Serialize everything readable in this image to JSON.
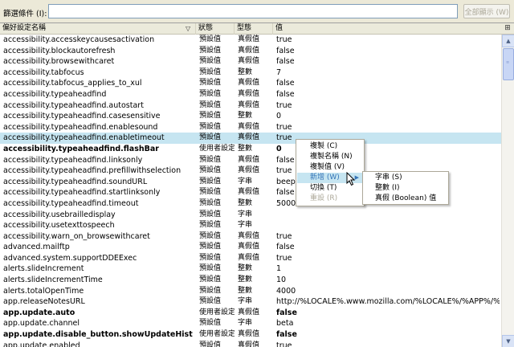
{
  "filter": {
    "label": "篩選條件 (I):",
    "value": "",
    "show_all_label": "全部顯示 (W)"
  },
  "columns": {
    "name": "偏好設定名稱",
    "status": "狀態",
    "type": "型態",
    "value": "值"
  },
  "icons": {
    "sort": "sort-indicator-icon",
    "column_picker": "column-picker-icon",
    "scroll_up": "scroll-up-arrow-icon",
    "scroll_down": "scroll-down-arrow-icon",
    "pointer": "mouse-pointer-icon"
  },
  "colors": {
    "selection": "#c6e5f1",
    "menu_hover_text": "#3574b7",
    "window_bg": "#ece9d8"
  },
  "rows": [
    {
      "name": "accessibility.accesskeycausesactivation",
      "status": "預設值",
      "type": "真假值",
      "value": "true",
      "bold": false
    },
    {
      "name": "accessibility.blockautorefresh",
      "status": "預設值",
      "type": "真假值",
      "value": "false",
      "bold": false
    },
    {
      "name": "accessibility.browsewithcaret",
      "status": "預設值",
      "type": "真假值",
      "value": "false",
      "bold": false
    },
    {
      "name": "accessibility.tabfocus",
      "status": "預設值",
      "type": "整數",
      "value": "7",
      "bold": false
    },
    {
      "name": "accessibility.tabfocus_applies_to_xul",
      "status": "預設值",
      "type": "真假值",
      "value": "false",
      "bold": false
    },
    {
      "name": "accessibility.typeaheadfind",
      "status": "預設值",
      "type": "真假值",
      "value": "false",
      "bold": false
    },
    {
      "name": "accessibility.typeaheadfind.autostart",
      "status": "預設值",
      "type": "真假值",
      "value": "true",
      "bold": false
    },
    {
      "name": "accessibility.typeaheadfind.casesensitive",
      "status": "預設值",
      "type": "整數",
      "value": "0",
      "bold": false
    },
    {
      "name": "accessibility.typeaheadfind.enablesound",
      "status": "預設值",
      "type": "真假值",
      "value": "true",
      "bold": false
    },
    {
      "name": "accessibility.typeaheadfind.enabletimeout",
      "status": "預設值",
      "type": "真假值",
      "value": "true",
      "bold": false,
      "selected": true
    },
    {
      "name": "accessibility.typeaheadfind.flashBar",
      "status": "使用者設定",
      "type": "整數",
      "value": "0",
      "bold": true
    },
    {
      "name": "accessibility.typeaheadfind.linksonly",
      "status": "預設值",
      "type": "真假值",
      "value": "false",
      "bold": false
    },
    {
      "name": "accessibility.typeaheadfind.prefillwithselection",
      "status": "預設值",
      "type": "真假值",
      "value": "true",
      "bold": false
    },
    {
      "name": "accessibility.typeaheadfind.soundURL",
      "status": "預設值",
      "type": "字串",
      "value": "beep",
      "bold": false
    },
    {
      "name": "accessibility.typeaheadfind.startlinksonly",
      "status": "預設值",
      "type": "真假值",
      "value": "false",
      "bold": false
    },
    {
      "name": "accessibility.typeaheadfind.timeout",
      "status": "預設值",
      "type": "整數",
      "value": "5000",
      "bold": false
    },
    {
      "name": "accessibility.usebrailledisplay",
      "status": "預設值",
      "type": "字串",
      "value": "",
      "bold": false
    },
    {
      "name": "accessibility.usetexttospeech",
      "status": "預設值",
      "type": "字串",
      "value": "",
      "bold": false
    },
    {
      "name": "accessibility.warn_on_browsewithcaret",
      "status": "預設值",
      "type": "真假值",
      "value": "true",
      "bold": false
    },
    {
      "name": "advanced.mailftp",
      "status": "預設值",
      "type": "真假值",
      "value": "false",
      "bold": false
    },
    {
      "name": "advanced.system.supportDDEExec",
      "status": "預設值",
      "type": "真假值",
      "value": "true",
      "bold": false
    },
    {
      "name": "alerts.slideIncrement",
      "status": "預設值",
      "type": "整數",
      "value": "1",
      "bold": false
    },
    {
      "name": "alerts.slideIncrementTime",
      "status": "預設值",
      "type": "整數",
      "value": "10",
      "bold": false
    },
    {
      "name": "alerts.totalOpenTime",
      "status": "預設值",
      "type": "整數",
      "value": "4000",
      "bold": false
    },
    {
      "name": "app.releaseNotesURL",
      "status": "預設值",
      "type": "字串",
      "value": "http://%LOCALE%.www.mozilla.com/%LOCALE%/%APP%/%VERSION%/...",
      "bold": false
    },
    {
      "name": "app.update.auto",
      "status": "使用者設定",
      "type": "真假值",
      "value": "false",
      "bold": true
    },
    {
      "name": "app.update.channel",
      "status": "預設值",
      "type": "字串",
      "value": "beta",
      "bold": false
    },
    {
      "name": "app.update.disable_button.showUpdateHistory",
      "status": "使用者設定",
      "type": "真假值",
      "value": "false",
      "bold": true
    },
    {
      "name": "app.update.enabled",
      "status": "預設值",
      "type": "真假值",
      "value": "true",
      "bold": false
    }
  ],
  "context_menu": {
    "items": [
      {
        "label": "複製 (C)",
        "state": "normal"
      },
      {
        "label": "複製名稱 (N)",
        "state": "normal"
      },
      {
        "label": "複製值 (V)",
        "state": "normal"
      },
      {
        "label": "新增 (W)",
        "state": "hover",
        "has_submenu": true
      },
      {
        "label": "切換 (T)",
        "state": "normal"
      },
      {
        "label": "重設 (R)",
        "state": "disabled"
      }
    ],
    "submenu_arrow": "▶"
  },
  "submenu": {
    "items": [
      {
        "label": "字串 (S)"
      },
      {
        "label": "整數 (I)"
      },
      {
        "label": "真假 (Boolean) 值"
      }
    ]
  }
}
